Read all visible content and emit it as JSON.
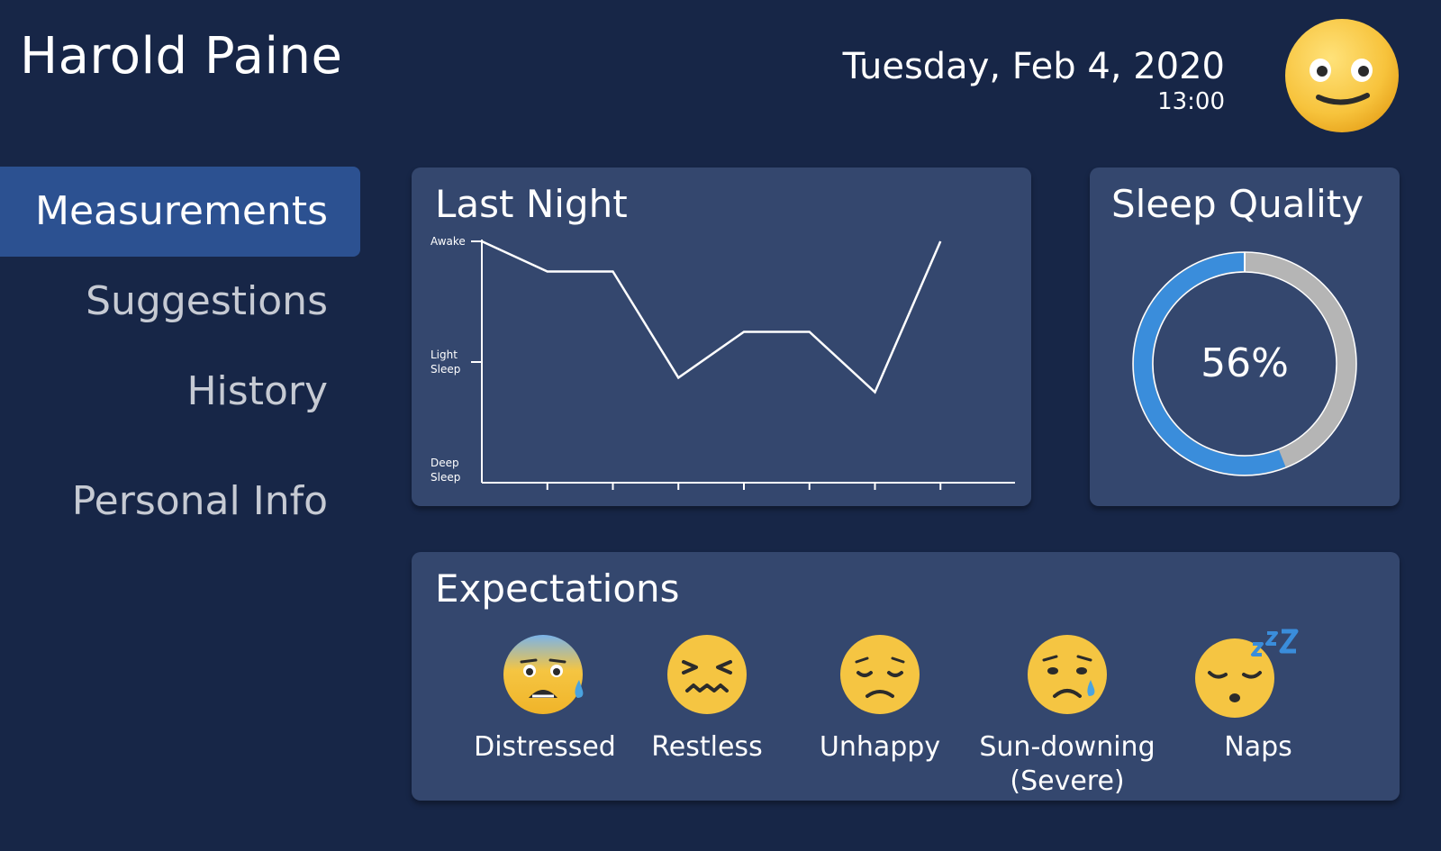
{
  "header": {
    "patient_name": "Harold Paine",
    "date": "Tuesday, Feb 4, 2020",
    "time": "13:00",
    "mood_icon": "slightly-smiling-face-icon"
  },
  "sidebar": {
    "items": [
      {
        "label": "Measurements",
        "active": true
      },
      {
        "label": "Suggestions",
        "active": false
      },
      {
        "label": "History",
        "active": false
      },
      {
        "label": "Personal Info",
        "active": false
      }
    ]
  },
  "last_night": {
    "title": "Last Night",
    "chart_data": {
      "type": "line",
      "title": "Last Night",
      "y_levels": [
        "Deep Sleep",
        "Light Sleep",
        "Awake"
      ],
      "y_tick_labels": [
        {
          "level": 2,
          "lines": [
            "Awake"
          ]
        },
        {
          "level": 1,
          "lines": [
            "Light",
            "Sleep"
          ]
        },
        {
          "level": 0,
          "lines": [
            "Deep",
            "Sleep"
          ]
        }
      ],
      "ylim": [
        0,
        2
      ],
      "x": [
        0,
        1,
        2,
        3,
        4,
        5,
        6,
        7
      ],
      "x_ticks": [
        1,
        2,
        3,
        4,
        5,
        6,
        7
      ],
      "xlim": [
        0,
        8
      ],
      "series": [
        {
          "values": [
            2,
            1.75,
            1.75,
            0.87,
            1.25,
            1.25,
            0.75,
            2
          ]
        }
      ],
      "grid": false
    }
  },
  "sleep_quality": {
    "title": "Sleep Quality",
    "percent_label": "56%",
    "value": 0.56,
    "colors": {
      "filled": "#3a8ddb",
      "remaining": "#b5b5b5"
    }
  },
  "expectations": {
    "title": "Expectations",
    "items": [
      {
        "label": "Distressed",
        "icon": "anxious-face-with-sweat-icon"
      },
      {
        "label": "Restless",
        "icon": "confounded-face-icon"
      },
      {
        "label": "Unhappy",
        "icon": "disappointed-face-icon"
      },
      {
        "label": "Sun-downing (Severe)",
        "icon": "crying-face-icon"
      },
      {
        "label": "Naps",
        "icon": "sleeping-face-icon"
      }
    ]
  },
  "colors": {
    "background": "#172647",
    "panel": "#34476e",
    "active_nav": "#2c5191",
    "inactive_text": "#c6cad3"
  }
}
